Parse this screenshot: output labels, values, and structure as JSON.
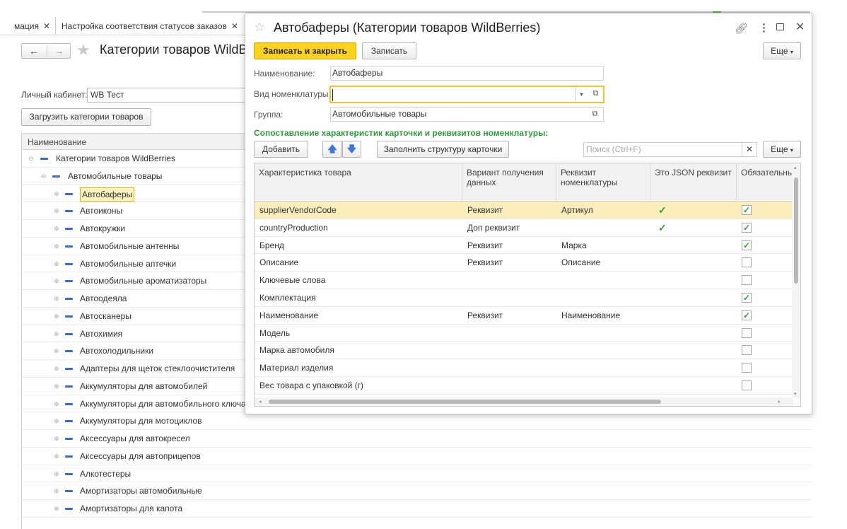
{
  "tabs": [
    {
      "label": "мация"
    },
    {
      "label": "Настройка соответствия статусов заказов"
    }
  ],
  "background": {
    "title": "Категории товаров WildBerries",
    "cabinet_label": "Личный кабинет:",
    "cabinet_value": "WB Тест",
    "load_button": "Загрузить категории товаров",
    "tree_header": "Наименование",
    "tree": [
      {
        "label": "Категории товаров WildBerries",
        "level": 0
      },
      {
        "label": "Автомобильные товары",
        "level": 1
      },
      {
        "label": "Автобаферы",
        "level": 2,
        "selected": true
      },
      {
        "label": "Автоиконы",
        "level": 2
      },
      {
        "label": "Автокружки",
        "level": 2
      },
      {
        "label": "Автомобильные антенны",
        "level": 2
      },
      {
        "label": "Автомобильные аптечки",
        "level": 2
      },
      {
        "label": "Автомобильные ароматизаторы",
        "level": 2
      },
      {
        "label": "Автоодеяла",
        "level": 2
      },
      {
        "label": "Автосканеры",
        "level": 2
      },
      {
        "label": "Автохимия",
        "level": 2
      },
      {
        "label": "Автохолодильники",
        "level": 2
      },
      {
        "label": "Адаптеры для щеток стеклоочистителя",
        "level": 2
      },
      {
        "label": "Аккумуляторы для автомобилей",
        "level": 2
      },
      {
        "label": "Аккумуляторы для автомобильного ключа",
        "level": 2
      },
      {
        "label": "Аккумуляторы для мотоциклов",
        "level": 2
      },
      {
        "label": "Аксессуары для автокресел",
        "level": 2
      },
      {
        "label": "Аксессуары для автоприцепов",
        "level": 2
      },
      {
        "label": "Алкотестеры",
        "level": 2
      },
      {
        "label": "Амортизаторы автомобильные",
        "level": 2
      },
      {
        "label": "Амортизаторы для капота",
        "level": 2
      }
    ]
  },
  "dialog": {
    "title": "Автобаферы (Категории товаров WildBerries)",
    "save_close": "Записать и закрыть",
    "save": "Записать",
    "more": "Еще",
    "fields": {
      "name_label": "Наименование:",
      "name_value": "Автобаферы",
      "kind_label": "Вид номенклатуры:",
      "kind_value": "",
      "group_label": "Группа:",
      "group_value": "Автомобильные товары"
    },
    "section_title": "Сопоставление характеристик карточки и реквизитов номенклатуры:",
    "add": "Добавить",
    "fill": "Заполнить структуру карточки",
    "search_placeholder": "Поиск (Ctrl+F)",
    "columns": [
      "Характеристика товара",
      "Вариант получения данных",
      "Реквизит номенклатуры",
      "Это JSON реквизит",
      "Обязательнь"
    ],
    "rows": [
      {
        "name": "supplierVendorCode",
        "variant": "Реквизит",
        "attr": "Артикул",
        "json": true,
        "required": true,
        "selected": true
      },
      {
        "name": "countryProduction",
        "variant": "Доп реквизит",
        "attr": "",
        "json": true,
        "required": true
      },
      {
        "name": "Бренд",
        "variant": "Реквизит",
        "attr": "Марка",
        "json": false,
        "required": true
      },
      {
        "name": "Описание",
        "variant": "Реквизит",
        "attr": "Описание",
        "json": false,
        "required": false
      },
      {
        "name": "Ключевые слова",
        "variant": "",
        "attr": "",
        "json": false,
        "required": false
      },
      {
        "name": "Комплектация",
        "variant": "",
        "attr": "",
        "json": false,
        "required": true
      },
      {
        "name": "Наименование",
        "variant": "Реквизит",
        "attr": "Наименование",
        "json": false,
        "required": true
      },
      {
        "name": "Модель",
        "variant": "",
        "attr": "",
        "json": false,
        "required": false
      },
      {
        "name": "Марка автомобиля",
        "variant": "",
        "attr": "",
        "json": false,
        "required": false
      },
      {
        "name": "Материал изделия",
        "variant": "",
        "attr": "",
        "json": false,
        "required": false
      },
      {
        "name": "Вес товара с упаковкой (г)",
        "variant": "",
        "attr": "",
        "json": false,
        "required": false
      }
    ]
  }
}
